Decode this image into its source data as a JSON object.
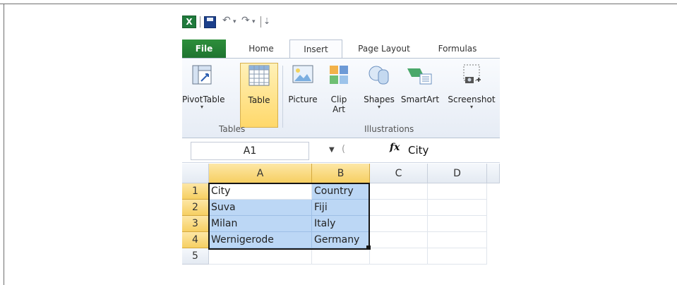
{
  "quick_access": {
    "logo": "X",
    "undo": "↶",
    "redo": "↷",
    "customize": "⇣"
  },
  "tabs": [
    {
      "label": "File"
    },
    {
      "label": "Home"
    },
    {
      "label": "Insert"
    },
    {
      "label": "Page Layout"
    },
    {
      "label": "Formulas"
    }
  ],
  "ribbon": {
    "groups": [
      {
        "label": "Tables",
        "buttons": [
          {
            "label": "PivotTable"
          },
          {
            "label": "Table"
          }
        ]
      },
      {
        "label": "Illustrations",
        "buttons": [
          {
            "label": "Picture"
          },
          {
            "label": "Clip\nArt"
          },
          {
            "label": "Shapes"
          },
          {
            "label": "SmartArt"
          },
          {
            "label": "Screenshot"
          }
        ]
      }
    ]
  },
  "formula_bar": {
    "name_box": "A1",
    "fx": "fx",
    "value": "City"
  },
  "columns": [
    "A",
    "B",
    "C",
    "D"
  ],
  "rows": [
    "1",
    "2",
    "3",
    "4",
    "5"
  ],
  "cells": [
    [
      "City",
      "Country",
      "",
      ""
    ],
    [
      "Suva",
      "Fiji",
      "",
      ""
    ],
    [
      "Milan",
      "Italy",
      "",
      ""
    ],
    [
      "Wernigerode",
      "Germany",
      "",
      ""
    ],
    [
      "",
      "",
      "",
      ""
    ]
  ],
  "colors": {
    "accent": "#1f7430",
    "selection": "#bcd7f5"
  }
}
